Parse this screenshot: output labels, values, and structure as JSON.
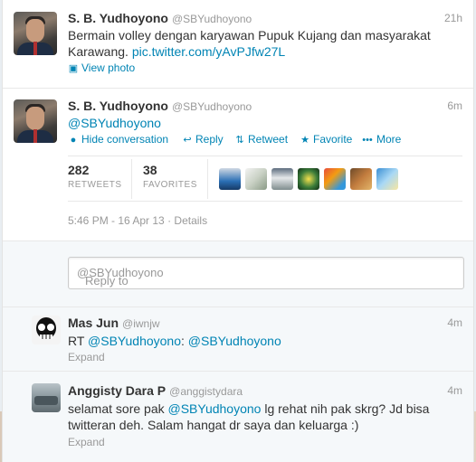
{
  "tweets": [
    {
      "name": "S. B. Yudhoyono",
      "handle": "@SBYudhoyono",
      "time": "21h",
      "text": "Bermain volley dengan karyawan Pupuk Kujang dan masyarakat Karawang.",
      "link": "pic.twitter.com/yAvPJfw27L",
      "action": "View photo"
    }
  ],
  "expanded": {
    "name": "S. B. Yudhoyono",
    "handle": "@SBYudhoyono",
    "time": "6m",
    "text": "@SBYudhoyono",
    "actions": {
      "hide": "Hide conversation",
      "reply": "Reply",
      "retweet": "Retweet",
      "favorite": "Favorite",
      "more": "More"
    },
    "stats": {
      "retweets_count": "282",
      "retweets_label": "RETWEETS",
      "favorites_count": "38",
      "favorites_label": "FAVORITES"
    },
    "footer": {
      "timestamp": "5:46 PM - 16 Apr 13",
      "dot": "·",
      "details": "Details"
    }
  },
  "reply_box": {
    "prefix": "Reply to",
    "mention": "@SBYudhoyono"
  },
  "replies": [
    {
      "name": "Mas Jun",
      "handle": "@iwnjw",
      "time": "4m",
      "text_prefix": "RT",
      "mention1": "@SBYudhoyono",
      "text_mid": ":",
      "mention2": "@SBYudhoyono",
      "expand": "Expand"
    },
    {
      "name": "Anggisty Dara P",
      "handle": "@anggistydara",
      "time": "4m",
      "text_prefix": "selamat sore pak",
      "mention": "@SBYudhoyono",
      "text_rest": "lg rehat nih pak skrg? Jd bisa twitteran deh. Salam hangat dr saya dan keluarga :)",
      "expand": "Expand"
    }
  ],
  "icons": [
    "photo-icon",
    "hide-conversation-icon",
    "reply-icon",
    "retweet-icon",
    "favorite-icon",
    "more-icon"
  ],
  "colors": {
    "link": "#0084b4",
    "muted": "#999999",
    "text": "#333333"
  }
}
